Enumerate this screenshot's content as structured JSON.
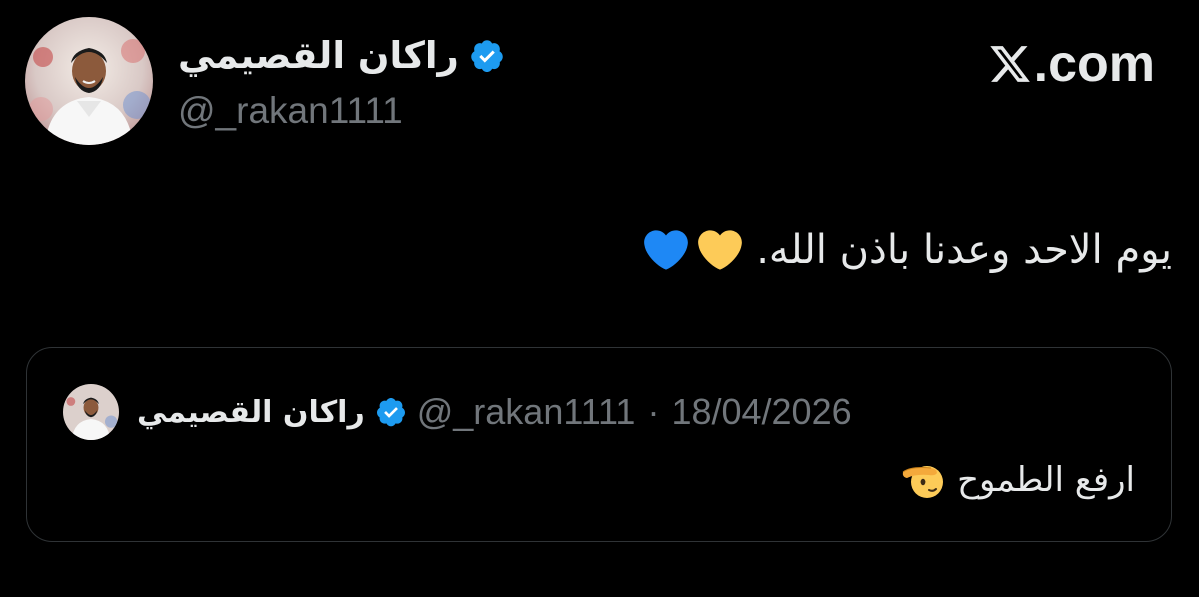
{
  "author": {
    "display_name": "راكان القصيمي",
    "handle": "@_rakan1111",
    "verified": true,
    "avatar_icon": "profile-photo"
  },
  "site": {
    "logo_icon": "x-logo-icon",
    "label": ".com"
  },
  "tweet": {
    "text": "يوم الاحد وعدنا باذن الله.",
    "emojis": [
      "yellow-heart",
      "blue-heart"
    ]
  },
  "quoted_tweet": {
    "display_name": "راكان القصيمي",
    "handle": "@_rakan1111",
    "separator": "·",
    "date": "18/04/2026",
    "text": "ارفع الطموح",
    "emoji": "saluting-face"
  },
  "colors": {
    "background": "#000000",
    "text_primary": "#e7e9ea",
    "text_secondary": "#71767b",
    "verified_blue": "#1d9bf0",
    "card_border": "#2f3336",
    "yellow_heart": "#fdcb58",
    "blue_heart": "#1e88f5"
  }
}
